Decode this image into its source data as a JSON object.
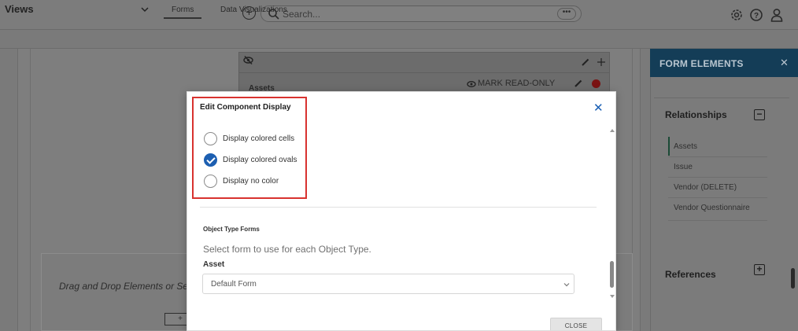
{
  "topbar": {
    "search_placeholder": "Search...",
    "more_label": "•••",
    "icons": [
      "add-circle-icon",
      "search-icon",
      "gear-icon",
      "help-icon",
      "user-icon"
    ]
  },
  "views": {
    "label": "Views",
    "tabs": [
      {
        "label": "Forms",
        "active": true
      },
      {
        "label": "Data Visualizations",
        "active": false
      }
    ]
  },
  "component": {
    "title": "Assets",
    "mark_read_only": "MARK READ-ONLY"
  },
  "dropzone": {
    "text": "Drag and Drop Elements or Se",
    "button": "+"
  },
  "form_elements": {
    "title": "FORM ELEMENTS",
    "close": "✕",
    "relationships_title": "Relationships",
    "relationships": [
      "Assets",
      "Issue",
      "Vendor (DELETE)",
      "Vendor Questionnaire"
    ],
    "references_title": "References"
  },
  "modal": {
    "title": "Edit Component Display",
    "close": "✕",
    "options": [
      {
        "label": "Display colored cells",
        "checked": false
      },
      {
        "label": "Display colored ovals",
        "checked": true
      },
      {
        "label": "Display no color",
        "checked": false
      }
    ],
    "section_title": "Object Type Forms",
    "section_desc": "Select form to use for each Object Type.",
    "field_label": "Asset",
    "field_value": "Default Form",
    "close_button": "CLOSE"
  },
  "colors": {
    "highlight": "#d8322f",
    "accent": "#1d5fb1",
    "panel_header": "#143d57"
  }
}
